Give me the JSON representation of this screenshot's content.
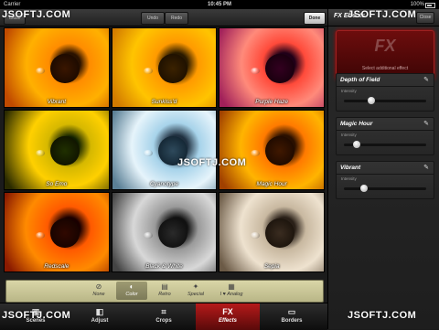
{
  "statusbar": {
    "carrier": "Carrier",
    "time": "10:45 PM",
    "battery": "100%"
  },
  "toolbar": {
    "close_label": "Close",
    "undo_label": "Undo",
    "redo_label": "Redo",
    "done_label": "Done"
  },
  "effects": [
    {
      "label": "Vibrant"
    },
    {
      "label": "Sunkiss'd"
    },
    {
      "label": "Purple Haze"
    },
    {
      "label": "So Emo"
    },
    {
      "label": "Cyanotype"
    },
    {
      "label": "Magic Hour"
    },
    {
      "label": "Redscale"
    },
    {
      "label": "Black & White"
    },
    {
      "label": "Sepia"
    }
  ],
  "filters": [
    {
      "label": "None",
      "icon": "none-icon"
    },
    {
      "label": "Color",
      "icon": "color-icon",
      "selected": true
    },
    {
      "label": "Retro",
      "icon": "retro-icon"
    },
    {
      "label": "Special",
      "icon": "special-icon"
    },
    {
      "label": "I ♥ Analog",
      "icon": "analog-icon"
    }
  ],
  "tabs": [
    {
      "label": "Scenes",
      "icon": "scenes-icon"
    },
    {
      "label": "Adjust",
      "icon": "adjust-icon"
    },
    {
      "label": "Crops",
      "icon": "crops-icon"
    },
    {
      "label": "Effects",
      "icon": "effects-icon",
      "active": true
    },
    {
      "label": "Borders",
      "icon": "borders-icon"
    }
  ],
  "panel": {
    "title": "FX Effects",
    "close_label": "Close",
    "banner_word": "FX",
    "banner_sub": "Select additional effect",
    "cards": [
      {
        "name": "Depth of Field",
        "slider_label": "Intensity",
        "value": 0.33
      },
      {
        "name": "Magic Hour",
        "slider_label": "Intensity",
        "value": 0.15
      },
      {
        "name": "Vibrant",
        "slider_label": "Intensity",
        "value": 0.24
      }
    ]
  },
  "watermark": "JSOFTJ.COM",
  "colors": {
    "active_tab": "#b51a1a",
    "filterbar": "#cfcc9d",
    "fx_banner": "#6d0d0d"
  }
}
